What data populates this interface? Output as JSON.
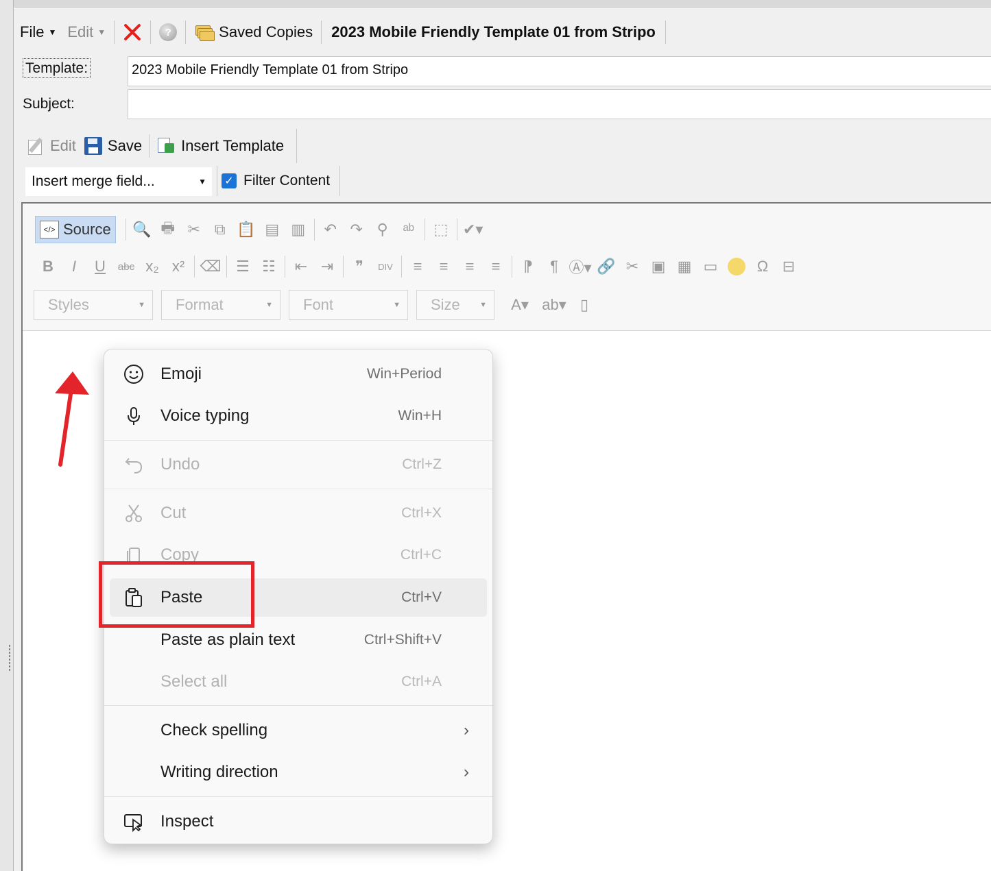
{
  "menubar": {
    "file": "File",
    "edit": "Edit",
    "saved_copies": "Saved Copies",
    "title": "2023 Mobile Friendly Template 01 from Stripo"
  },
  "fields": {
    "template_label": "Template:",
    "template_value": "2023 Mobile Friendly Template 01 from Stripo",
    "subject_label": "Subject:",
    "subject_value": ""
  },
  "editor_toolbar": {
    "edit": "Edit",
    "save": "Save",
    "insert_template": "Insert Template",
    "merge_field": "Insert merge field...",
    "filter_content": "Filter Content",
    "filter_checked": true
  },
  "ck": {
    "source": "Source",
    "styles": "Styles",
    "format": "Format",
    "font": "Font",
    "size": "Size"
  },
  "context_menu": {
    "items": [
      {
        "label": "Emoji",
        "shortcut": "Win+Period",
        "icon": "emoji-icon"
      },
      {
        "label": "Voice typing",
        "shortcut": "Win+H",
        "icon": "microphone-icon"
      },
      {
        "label": "Undo",
        "shortcut": "Ctrl+Z",
        "icon": "undo-icon",
        "disabled": true
      },
      {
        "label": "Cut",
        "shortcut": "Ctrl+X",
        "icon": "scissors-icon",
        "disabled": true
      },
      {
        "label": "Copy",
        "shortcut": "Ctrl+C",
        "icon": "copy-icon",
        "disabled": true
      },
      {
        "label": "Paste",
        "shortcut": "Ctrl+V",
        "icon": "paste-icon",
        "highlighted": true
      },
      {
        "label": "Paste as plain text",
        "shortcut": "Ctrl+Shift+V"
      },
      {
        "label": "Select all",
        "shortcut": "Ctrl+A",
        "disabled": true
      },
      {
        "label": "Check spelling",
        "submenu": true
      },
      {
        "label": "Writing direction",
        "submenu": true
      },
      {
        "label": "Inspect",
        "icon": "inspect-icon"
      }
    ]
  },
  "colors": {
    "accent_red": "#e3242b",
    "checkbox_blue": "#1b73d8"
  }
}
